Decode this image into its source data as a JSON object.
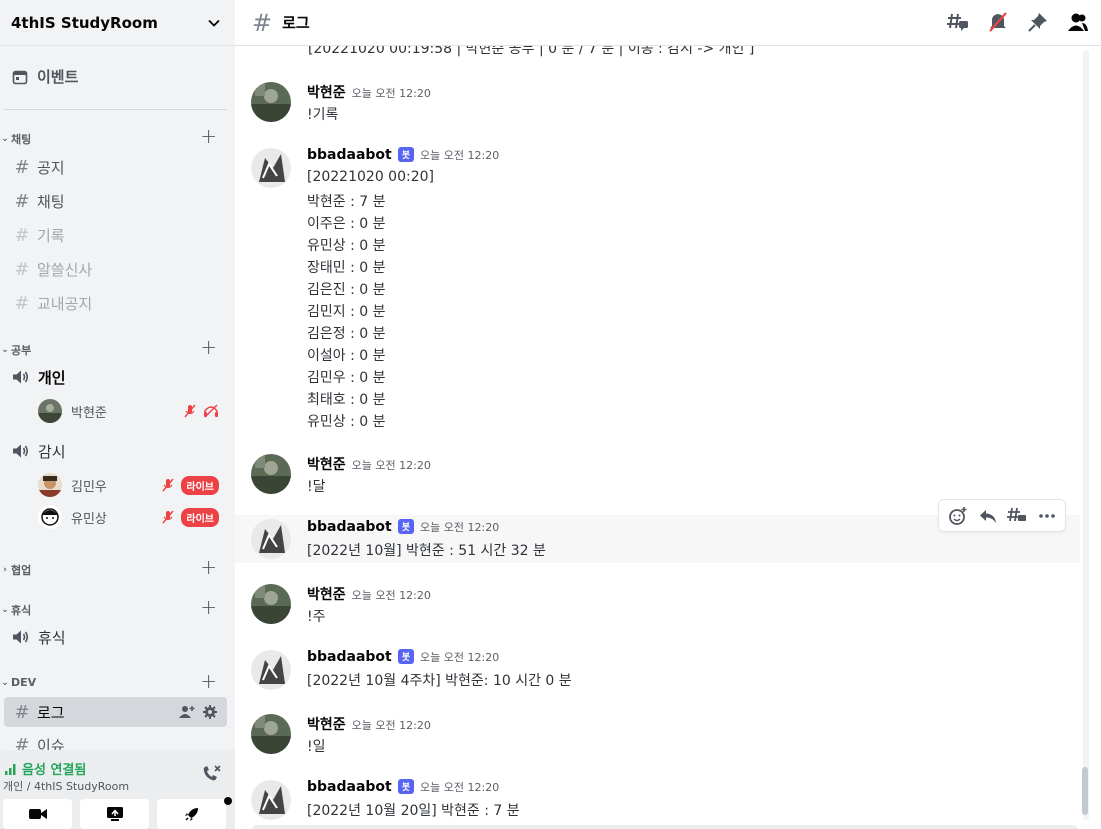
{
  "server": {
    "name": "4thIS StudyRoom"
  },
  "sidebar": {
    "events_label": "이벤트",
    "categories": [
      {
        "name": "채팅"
      },
      {
        "name": "공부"
      },
      {
        "name": "협업"
      },
      {
        "name": "휴식"
      },
      {
        "name": "DEV"
      }
    ],
    "chat_channels": [
      "공지",
      "채팅",
      "기록",
      "알쓸신사",
      "교내공지"
    ],
    "voice_private": {
      "name": "개인",
      "members": [
        "박현준"
      ]
    },
    "voice_watch": {
      "name": "감시",
      "members": [
        "김민우",
        "유민상"
      ],
      "live_label": "라이브"
    },
    "rest_channel": "휴식",
    "dev_channels": [
      "로그",
      "이슈"
    ]
  },
  "voice": {
    "status": "음성 연결됨",
    "location": "개인 / 4thIS StudyRoom"
  },
  "header": {
    "channel": "로그"
  },
  "messages": {
    "cut_line": "[20221020 00:19:58 | 박현준 공부 | 0 분 / 7 분 | 이동 : 감시 -> 개인 ]",
    "time": "오늘 오전 12:20",
    "bot_badge": "봇",
    "user": "박현준",
    "bot": "bbadaabot",
    "m1": "!기록",
    "m2_lines": [
      "[20221020 00:20]",
      "박현준 : 7 분",
      "이주은 : 0 분",
      "유민상 : 0 분",
      "장태민 : 0 분",
      "김은진 : 0 분",
      "김민지 : 0 분",
      "김은정 : 0 분",
      "이설아 : 0 분",
      "김민우 : 0 분",
      "최태호 : 0 분",
      "유민상 : 0 분"
    ],
    "m3": "!달",
    "m4": "[2022년 10월] 박현준 : 51 시간 32 분",
    "m5": "!주",
    "m6": "[2022년 10월 4주차] 박현준: 10 시간 0 분",
    "m7": "!일",
    "m8": "[2022년 10월 20일] 박현준 : 7 분"
  },
  "colors": {
    "accent": "#5865f2",
    "live": "#ed4245",
    "connected": "#23a55a",
    "muted_icon": "#ed4245"
  }
}
